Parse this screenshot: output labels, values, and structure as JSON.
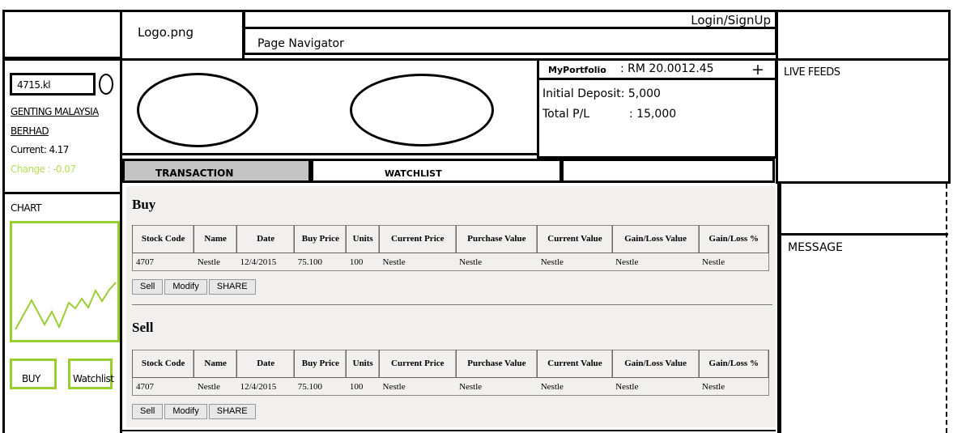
{
  "header": {
    "logo": "Logo.png",
    "login": "Login/SignUp",
    "nav": "Page Navigator"
  },
  "stock": {
    "code": "4715.kl",
    "name_line1": "GENTING MALAYSIA",
    "name_line2": "BERHAD",
    "current": "Current: 4.17",
    "change": "Change : -0.07",
    "change_color": "#b6e05a"
  },
  "chart": {
    "label": "CHART",
    "line_color": "#9acd32",
    "buy": "BUY",
    "watchlist": "Watchlist"
  },
  "portfolio": {
    "title": "MyPortfolio",
    "value": ": RM 20.0012.45",
    "plus": "+",
    "deposit": "Initial Deposit: 5,000",
    "pl_label": "Total P/L",
    "pl_value": ": 15,000"
  },
  "right": {
    "live_feeds": "LIVE FEEDS",
    "message": "MESSAGE"
  },
  "tabs": {
    "transaction": "TRANSACTION",
    "watchlist": "WATCHLIST"
  },
  "columns": [
    "Stock Code",
    "Name",
    "Date",
    "Buy Price",
    "Units",
    "Current Price",
    "Purchase Value",
    "Current Value",
    "Gain/Loss Value",
    "Gain/Loss %"
  ],
  "buy": {
    "title": "Buy",
    "row": [
      "4707",
      "Nestle",
      "12/4/2015",
      "75.100",
      "100",
      "Nestle",
      "Nestle",
      "Nestle",
      "Nestle",
      "Nestle"
    ],
    "actions": [
      "Sell",
      "Modify",
      "SHARE"
    ]
  },
  "sell": {
    "title": "Sell",
    "row": [
      "4707",
      "Nestle",
      "12/4/2015",
      "75.100",
      "100",
      "Nestle",
      "Nestle",
      "Nestle",
      "Nestle",
      "Nestle"
    ],
    "actions": [
      "Sell",
      "Modify",
      "SHARE"
    ]
  }
}
